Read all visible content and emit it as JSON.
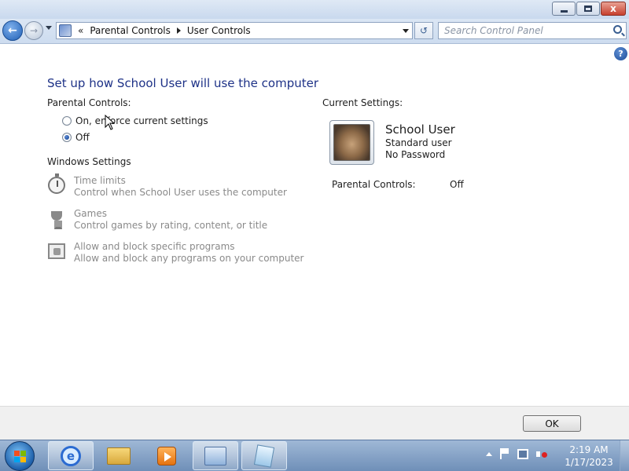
{
  "window": {
    "minimize_glyph": "",
    "close_glyph": "x"
  },
  "nav": {
    "back_glyph": "←",
    "forward_glyph": "→",
    "chevron": "«",
    "breadcrumbs": [
      "Parental Controls",
      "User Controls"
    ],
    "refresh_glyph": "↺",
    "search_placeholder": "Search Control Panel"
  },
  "help_glyph": "?",
  "page": {
    "heading": "Set up how School User will use the computer",
    "parental_controls_label": "Parental Controls:",
    "options": [
      {
        "label": "On, enforce current settings",
        "checked": false
      },
      {
        "label": "Off",
        "checked": true
      }
    ],
    "windows_settings_label": "Windows Settings",
    "settings": [
      {
        "title": "Time limits",
        "desc": "Control when School User uses the computer",
        "icon": "stopwatch-icon"
      },
      {
        "title": "Games",
        "desc": "Control games by rating, content, or title",
        "icon": "trophy-icon"
      },
      {
        "title": "Allow and block specific programs",
        "desc": "Allow and block any programs on your computer",
        "icon": "programs-icon"
      }
    ]
  },
  "current": {
    "label": "Current Settings:",
    "user_name": "School User",
    "account_type": "Standard user",
    "password_status": "No Password",
    "pc_label": "Parental Controls:",
    "pc_value": "Off"
  },
  "footer": {
    "ok_label": "OK"
  },
  "taskbar": {
    "ie_glyph": "e",
    "time": "2:19 AM",
    "date": "1/17/2023"
  },
  "colors": {
    "heading": "#1e3287",
    "disabled_text": "#8a8a8a",
    "taskbar": "#6f8fb8"
  }
}
